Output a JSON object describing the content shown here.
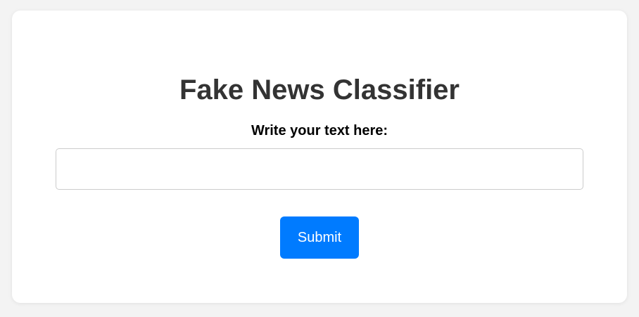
{
  "page": {
    "title": "Fake News Classifier",
    "input_label": "Write your text here:",
    "input_value": "",
    "input_placeholder": "",
    "submit_label": "Submit"
  },
  "colors": {
    "background": "#f3f3f3",
    "card": "#ffffff",
    "title_text": "#333333",
    "button": "#007bff",
    "button_text": "#ffffff"
  }
}
